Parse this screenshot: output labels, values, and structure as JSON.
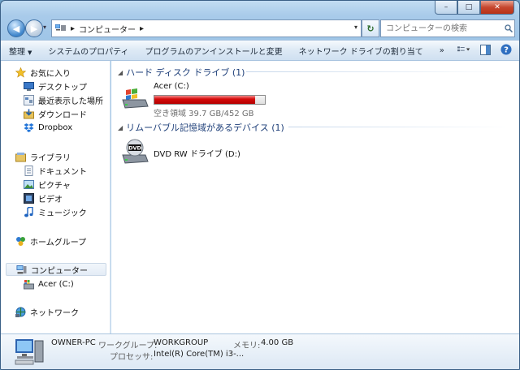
{
  "window": {
    "caption_buttons": {
      "minimize": "–",
      "maximize": "□",
      "close": "✕"
    }
  },
  "address": {
    "back_glyph": "◀",
    "forward_glyph": "▶",
    "segment_separator": "▸",
    "segment": "コンピューター",
    "after_separator": "▸",
    "refresh_glyph": "↻",
    "search_placeholder": "コンピューターの検索"
  },
  "toolbar": {
    "organize": "整理",
    "items": [
      "システムのプロパティ",
      "プログラムのアンインストールと変更",
      "ネットワーク ドライブの割り当て"
    ],
    "overflow": "»"
  },
  "nav": {
    "favorites": "お気に入り",
    "desktop": "デスクトップ",
    "recent": "最近表示した場所",
    "downloads": "ダウンロード",
    "dropbox": "Dropbox",
    "libraries": "ライブラリ",
    "documents": "ドキュメント",
    "pictures": "ピクチャ",
    "videos": "ビデオ",
    "music": "ミュージック",
    "homegroup": "ホームグループ",
    "computer": "コンピューター",
    "acer_c": "Acer (C:)",
    "network": "ネットワーク"
  },
  "groups": {
    "hdd_header": "ハード ディスク ドライブ (1)",
    "removable_header": "リムーバブル記憶域があるデバイス (1)"
  },
  "drives": {
    "c_name": "Acer (C:)",
    "c_info": "空き領域 39.7 GB/452 GB",
    "c_used_fraction": 0.912,
    "dvd_name": "DVD RW ドライブ (D:)",
    "dvd_icon_label": "DVD"
  },
  "details": {
    "computer_name": "OWNER-PC",
    "workgroup_label": "ワークグループ:",
    "workgroup_value": "WORKGROUP",
    "memory_label": "メモリ:",
    "memory_value": "4.00 GB",
    "processor_label": "プロセッサ:",
    "processor_value": "Intel(R) Core(TM) i3-..."
  },
  "colors": {
    "drive_fill": "#d60c0c",
    "group_header": "#1e3f79"
  }
}
